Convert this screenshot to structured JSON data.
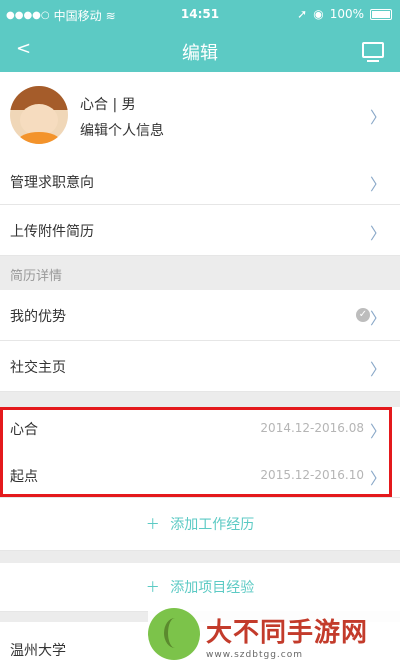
{
  "statusbar": {
    "carrier": "中国移动",
    "time": "14:51",
    "battery": "100%"
  },
  "navbar": {
    "back": "<",
    "title": "编辑"
  },
  "profile": {
    "name": "心合 | 男",
    "edit_link": "编辑个人信息"
  },
  "rows": {
    "job_intent": "管理求职意向",
    "upload_resume": "上传附件简历"
  },
  "resume_details": {
    "header": "简历详情",
    "advantages": "我的优势",
    "social": "社交主页"
  },
  "work_experience": [
    {
      "company": "心合",
      "period": "2014.12-2016.08"
    },
    {
      "company": "起点",
      "period": "2015.12-2016.10"
    }
  ],
  "actions": {
    "add_work": "添加工作经历",
    "add_project": "添加项目经验"
  },
  "education": {
    "school": "温州大学"
  },
  "watermark": {
    "text": "大不同手游网",
    "url": "www.szdbtgg.com"
  },
  "colors": {
    "accent": "#5ccac4",
    "highlight_border": "#e4191c"
  }
}
